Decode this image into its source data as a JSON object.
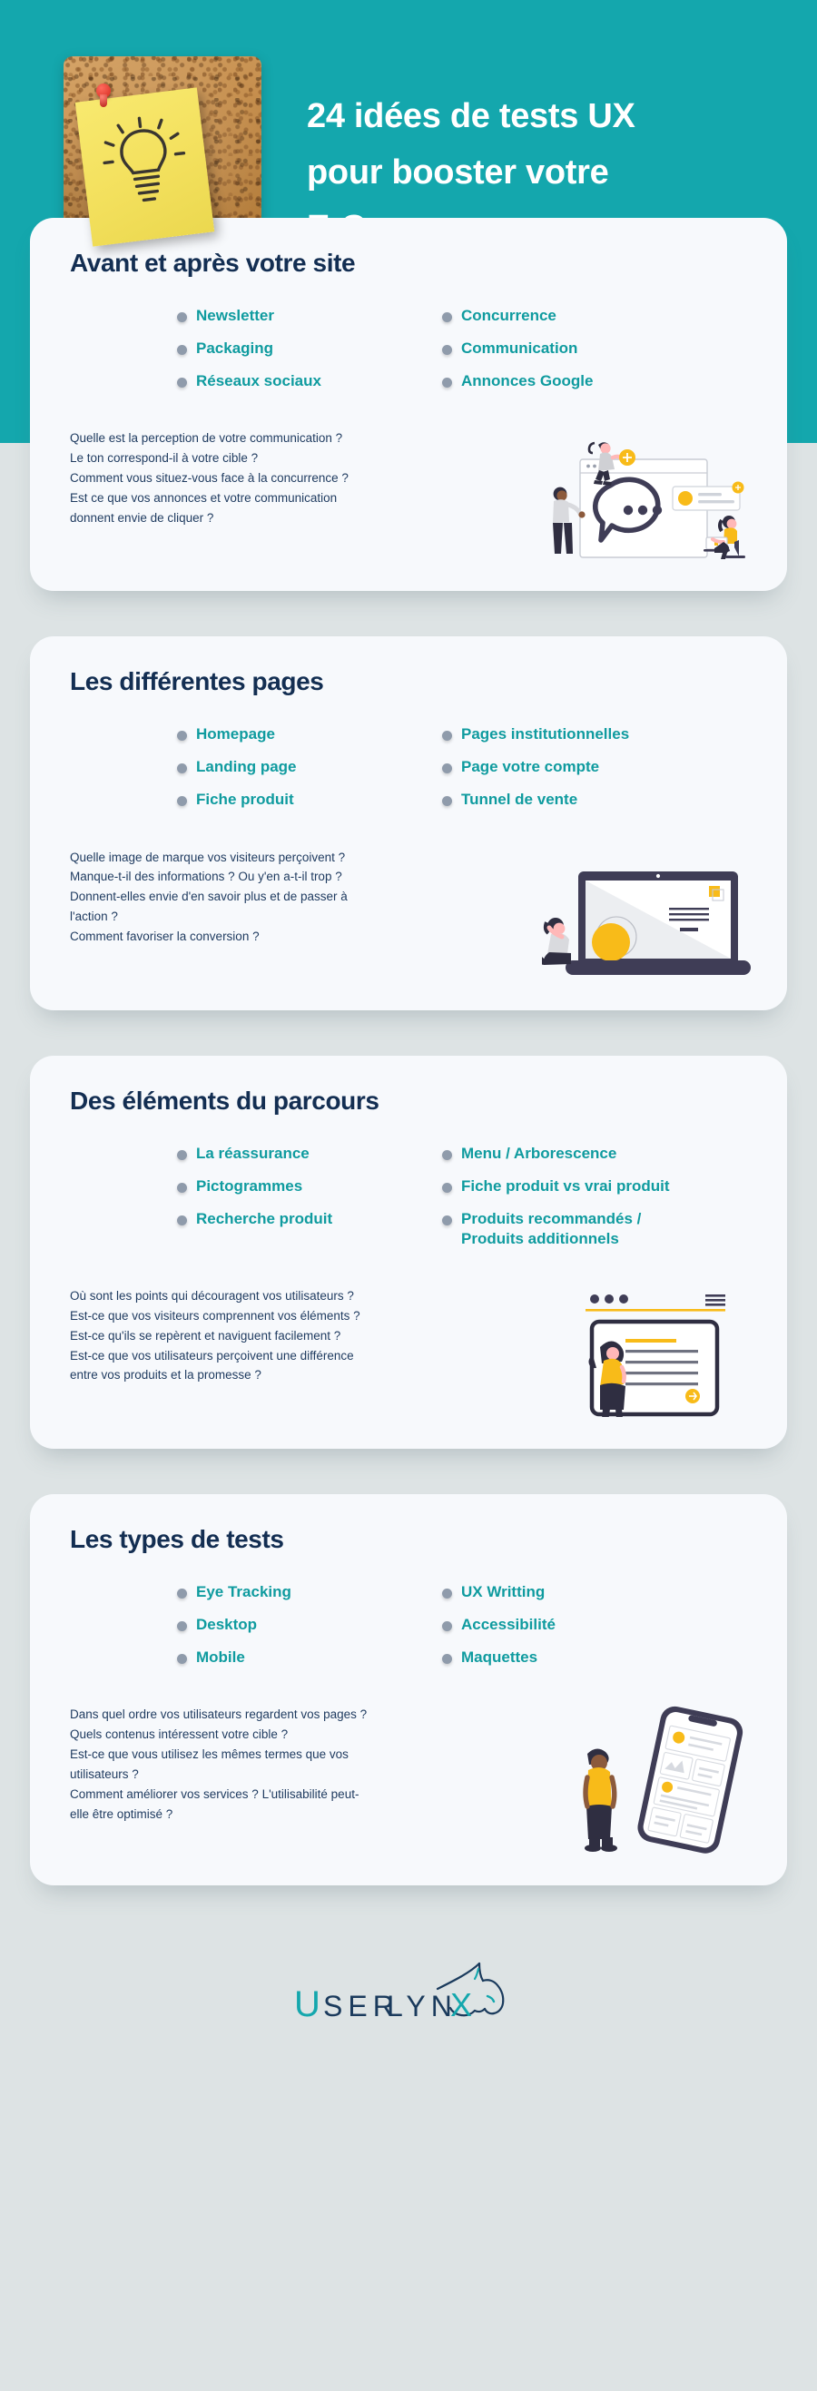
{
  "header": {
    "title_line1": "24 idées de tests UX",
    "title_line2": "pour booster votre",
    "title_line3": "E-Commerce",
    "photo_alt": "cork-board-sticky-note-lightbulb"
  },
  "colors": {
    "teal_header": "#14a7ad",
    "page_background": "#dde3e4",
    "card_background": "#f7f9fc",
    "heading_navy": "#132e52",
    "chip_teal": "#0f9b9f",
    "chip_dot_grey": "#8f9bab",
    "body_navy": "#1e3a5f",
    "accent_yellow": "#f8bb19",
    "illustration_dark": "#3f3d56"
  },
  "sections": [
    {
      "title": "Avant et après votre site",
      "chips_left": [
        "Newsletter",
        "Packaging",
        "Réseaux sociaux"
      ],
      "chips_right": [
        "Concurrence",
        "Communication",
        "Annonces Google"
      ],
      "questions": "Quelle est la perception de votre communication ?\nLe ton correspond-il à votre cible ?\nComment vous situez-vous face à la concurrence ?\nEst ce que vos annonces et votre communication\ndonnent envie de cliquer ?",
      "illustration": "browser-chat-bubble-people"
    },
    {
      "title": "Les différentes pages",
      "chips_left": [
        "Homepage",
        "Landing page",
        "Fiche produit"
      ],
      "chips_right": [
        "Pages institutionnelles",
        "Page votre compte",
        "Tunnel de vente"
      ],
      "questions": "Quelle image de marque vos visiteurs perçoivent ?\nManque-t-il des informations ? Ou y'en a-t-il trop ?\nDonnent-elles envie d'en savoir plus et de passer à\nl'action ?\nComment favoriser la conversion ?",
      "illustration": "laptop-person-sitting"
    },
    {
      "title": "Des éléments du parcours",
      "chips_left": [
        "La réassurance",
        "Pictogrammes",
        "Recherche produit"
      ],
      "chips_right": [
        "Menu / Arborescence",
        "Fiche produit vs vrai produit",
        "Produits recommandés /\nProduits additionnels"
      ],
      "questions": "Où sont les points qui découragent vos utilisateurs ?\nEst-ce que vos visiteurs comprennent vos éléments ?\nEst-ce qu'ils se repèrent et naviguent facilement ?\nEst-ce que vos utilisateurs perçoivent une différence\nentre vos produits et la promesse ?",
      "illustration": "browser-window-woman-reading"
    },
    {
      "title": "Les types de tests",
      "chips_left": [
        "Eye Tracking",
        "Desktop",
        "Mobile"
      ],
      "chips_right": [
        "UX Writting",
        "Accessibilité",
        "Maquettes"
      ],
      "questions": "Dans quel ordre vos utilisateurs regardent vos pages ?\nQuels contenus intéressent votre cible ?\nEst-ce que vous utilisez les mêmes termes que vos\nutilisateurs ?\nComment améliorer vos services ? L'utilisabilité peut-\nelle être optimisé ?",
      "illustration": "smartphone-person-standing"
    }
  ],
  "footer": {
    "brand_part1": "U",
    "brand_part2": "SER",
    "brand_part3": "LYN",
    "brand_part4": "X",
    "brand_full": "USERLYNX",
    "logo_mark": "lynx-head-icon"
  }
}
